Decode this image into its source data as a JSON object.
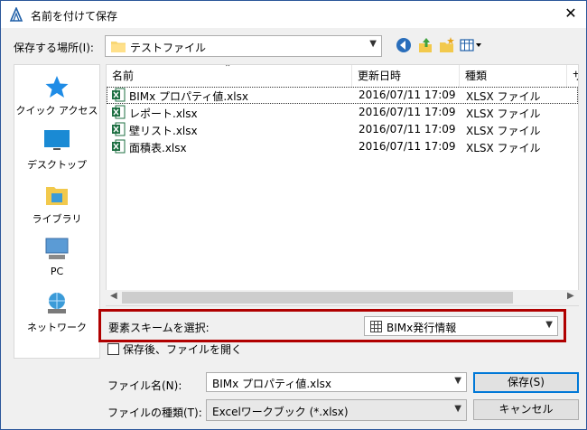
{
  "window": {
    "title": "名前を付けて保存",
    "close_label": "✕"
  },
  "toolbar": {
    "location_label": "保存する場所(I):",
    "location_value": "テストファイル"
  },
  "places": [
    {
      "label": "クイック アクセス",
      "icon": "star-icon"
    },
    {
      "label": "デスクトップ",
      "icon": "desktop-icon"
    },
    {
      "label": "ライブラリ",
      "icon": "library-icon"
    },
    {
      "label": "PC",
      "icon": "pc-icon"
    },
    {
      "label": "ネットワーク",
      "icon": "network-icon"
    }
  ],
  "file_list": {
    "columns": [
      "名前",
      "更新日時",
      "種類",
      "サ"
    ],
    "rows": [
      {
        "name": "BIMx プロパティ値.xlsx",
        "date": "2016/07/11 17:09",
        "type": "XLSX ファイル"
      },
      {
        "name": "レポート.xlsx",
        "date": "2016/07/11 17:09",
        "type": "XLSX ファイル"
      },
      {
        "name": "壁リスト.xlsx",
        "date": "2016/07/11 17:09",
        "type": "XLSX ファイル"
      },
      {
        "name": "面積表.xlsx",
        "date": "2016/07/11 17:09",
        "type": "XLSX ファイル"
      }
    ]
  },
  "scheme": {
    "label": "要素スキームを選択:",
    "value": "BIMx発行情報"
  },
  "options": {
    "open_after_save_label": "保存後、ファイルを開く",
    "open_after_save_checked": false
  },
  "footer": {
    "filename_label": "ファイル名(N):",
    "filename_value": "BIMx プロパティ値.xlsx",
    "filetype_label": "ファイルの種類(T):",
    "filetype_value": "Excelワークブック (*.xlsx)",
    "save_label": "保存(S)",
    "cancel_label": "キャンセル"
  },
  "colors": {
    "accent": "#0078d7",
    "highlight_border": "#b00000",
    "excel_green": "#1d6f42"
  }
}
